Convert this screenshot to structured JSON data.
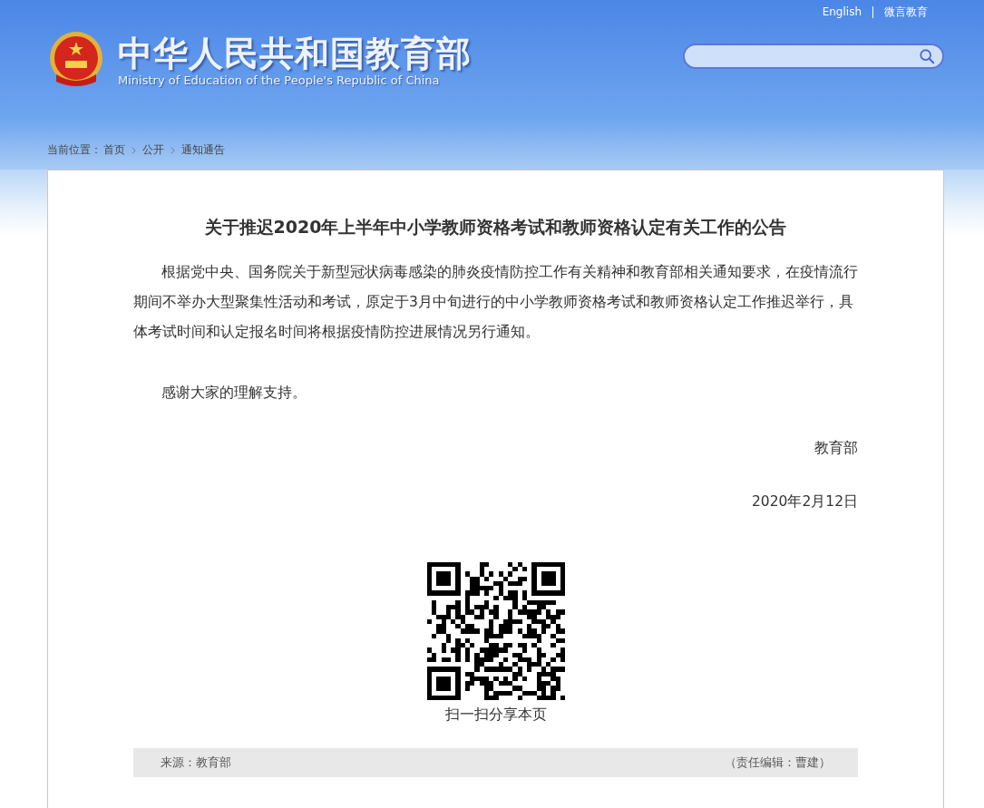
{
  "header": {
    "title": "中华人民共和国教育部",
    "subtitle": "Ministry of Education of the People's Republic of China",
    "links": [
      "English",
      "微言教育"
    ]
  },
  "breadcrumb": {
    "label": "当前位置：",
    "items": [
      "首页",
      "公开",
      "通知通告"
    ]
  },
  "article": {
    "title": "关于推迟2020年上半年中小学教师资格考试和教师资格认定有关工作的公告",
    "paragraphs": [
      "根据党中央、国务院关于新型冠状病毒感染的肺炎疫情防控工作有关精神和教育部相关通知要求，在疫情流行期间不举办大型聚集性活动和考试，原定于3月中旬进行的中小学教师资格考试和教师资格认定工作推迟举行，具体考试时间和认定报名时间将根据疫情防控进展情况另行通知。",
      "感谢大家的理解支持。"
    ],
    "signature": "教育部",
    "date": "2020年2月12日",
    "qr_caption": "扫一扫分享本页"
  },
  "footer_bar": {
    "source": "来源：教育部",
    "editor": "（责任编辑：曹建）"
  }
}
